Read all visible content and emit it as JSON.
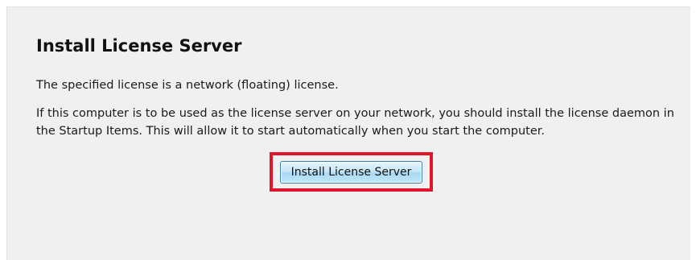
{
  "dialog": {
    "title": "Install License Server",
    "message_1": "The specified license is a network (floating) license.",
    "message_2": "If this computer is to be used as the license server on your network, you should install the license daemon in the Startup Items. This will allow it to start automatically when you start the computer.",
    "install_button_label": "Install License Server"
  },
  "colors": {
    "panel_background": "#f0f0f0",
    "highlight_border": "#e0142a",
    "button_border": "#3c7fb1"
  }
}
